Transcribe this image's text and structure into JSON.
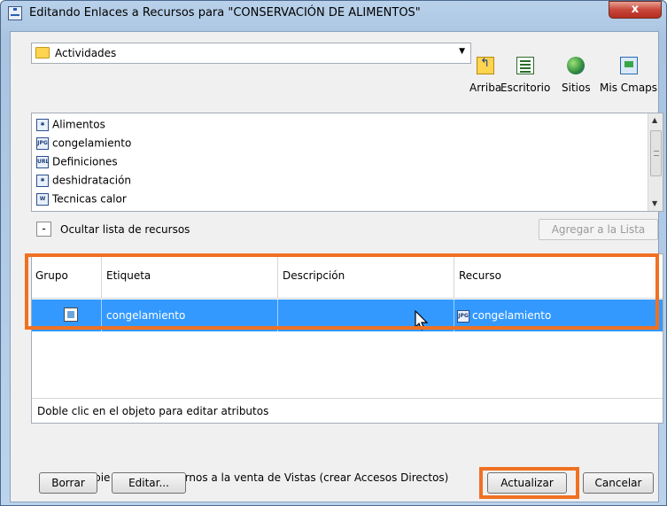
{
  "window": {
    "title": "Editando Enlaces a Recursos para \"CONSERVACIÓN DE ALIMENTOS\"",
    "close_glyph": "x"
  },
  "location": {
    "selected": "Actividades"
  },
  "toolbar": {
    "up_label": "Arriba",
    "desktop_label": "Escritorio",
    "sites_label": "Sitios",
    "mycmaps_label": "Mis Cmaps"
  },
  "resources": {
    "items": [
      {
        "label": "Alimentos",
        "icon": "cmap-icon"
      },
      {
        "label": "congelamiento",
        "icon": "jpg-icon"
      },
      {
        "label": "Definiciones",
        "icon": "url-icon"
      },
      {
        "label": "deshidratación",
        "icon": "cmap-icon"
      },
      {
        "label": "Tecnicas calor",
        "icon": "doc-icon"
      }
    ]
  },
  "hide_list": {
    "glyph": "-",
    "label": "Ocultar lista de recursos"
  },
  "add_button": "Agregar a la Lista",
  "table": {
    "headers": {
      "group": "Grupo",
      "label": "Etiqueta",
      "description": "Descripción",
      "resource": "Recurso"
    },
    "rows": [
      {
        "label": "congelamiento",
        "description": "",
        "resource": "congelamiento",
        "selected": true
      }
    ],
    "status": "Doble clic en el objeto para editar atributos"
  },
  "no_copy_label": "No copie archivos externos a la venta de Vistas (crear Accesos Directos)",
  "buttons": {
    "delete": "Borrar",
    "edit": "Editar...",
    "update": "Actualizar",
    "cancel": "Cancelar"
  },
  "colors": {
    "selection": "#3399ff",
    "highlight": "#f07122"
  }
}
